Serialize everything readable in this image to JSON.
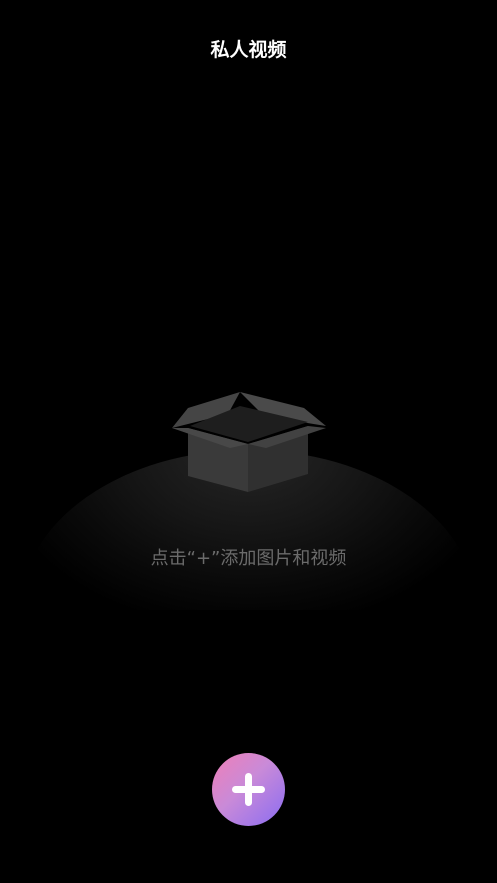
{
  "header": {
    "title": "私人视频"
  },
  "empty_state": {
    "illustration_icon": "open-box-icon",
    "hint": "点击“+”添加图片和视频"
  },
  "fab": {
    "icon": "plus-icon",
    "gradient_start": "#f07fb6",
    "gradient_end": "#8a6cf2"
  },
  "colors": {
    "background": "#000000",
    "title_text": "#ffffff",
    "hint_text": "#6b6b6b"
  }
}
